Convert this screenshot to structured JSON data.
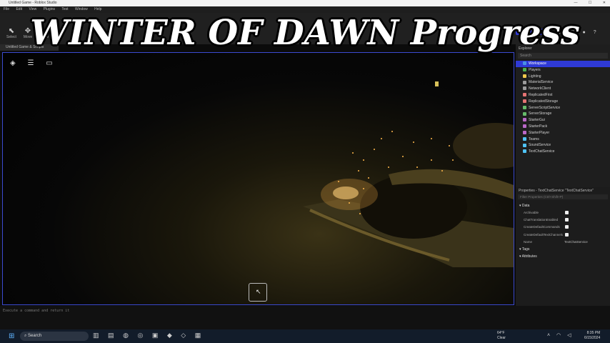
{
  "window": {
    "title": "Untitled Game - Roblox Studio",
    "controls": [
      "—",
      "☐",
      "✕"
    ]
  },
  "menu": [
    "File",
    "Edit",
    "View",
    "Plugins",
    "Test",
    "Window",
    "Help"
  ],
  "ribbon": {
    "tools": [
      {
        "icon": "⬉",
        "label": "Select"
      },
      {
        "icon": "✥",
        "label": "Move"
      },
      {
        "icon": "⤢",
        "label": "Scale"
      }
    ],
    "update_button": "Restart to Update"
  },
  "document_tab": "Untitled Game & Scripts",
  "overlay_title": "WINTER OF DAWN Progress",
  "viewport": {
    "cursor_glyph": "↖"
  },
  "command_bar": {
    "placeholder": "Execute a command and return it"
  },
  "explorer": {
    "header": "Explorer",
    "search_placeholder": "Search",
    "items": [
      {
        "label": "Workspace",
        "color": "#4a90e2",
        "selected": true
      },
      {
        "label": "Players",
        "color": "#4caf50"
      },
      {
        "label": "Lighting",
        "color": "#f2c94c"
      },
      {
        "label": "MaterialService",
        "color": "#9b9b9b"
      },
      {
        "label": "NetworkClient",
        "color": "#9b9b9b"
      },
      {
        "label": "ReplicatedFirst",
        "color": "#e57373"
      },
      {
        "label": "ReplicatedStorage",
        "color": "#e57373"
      },
      {
        "label": "ServerScriptService",
        "color": "#66bb6a"
      },
      {
        "label": "ServerStorage",
        "color": "#66bb6a"
      },
      {
        "label": "StarterGui",
        "color": "#ba68c8"
      },
      {
        "label": "StarterPack",
        "color": "#ba68c8"
      },
      {
        "label": "StarterPlayer",
        "color": "#ba68c8"
      },
      {
        "label": "Teams",
        "color": "#4fc3f7"
      },
      {
        "label": "SoundService",
        "color": "#4fc3f7"
      },
      {
        "label": "TextChatService",
        "color": "#4fc3f7"
      }
    ]
  },
  "properties": {
    "header": "Properties - TextChatService \"TextChatService\"",
    "filter_placeholder": "Filter Properties (Ctrl+Shift+P)",
    "sections": [
      {
        "title": "Data",
        "rows": [
          {
            "label": "Archivable",
            "type": "check"
          },
          {
            "label": "ChatTranslationEnabled",
            "type": "check"
          },
          {
            "label": "CreateDefaultCommands",
            "type": "check"
          },
          {
            "label": "CreateDefaultTextChannels",
            "type": "check"
          },
          {
            "label": "Name",
            "type": "text",
            "value": "TextChatService"
          }
        ]
      },
      {
        "title": "Tags",
        "rows": []
      },
      {
        "title": "Attributes",
        "rows": []
      }
    ]
  },
  "taskbar": {
    "search_label": "Search",
    "weather_temp": "64°F",
    "weather_desc": "Clear",
    "time": "8:35 PM",
    "date": "6/15/2024"
  }
}
